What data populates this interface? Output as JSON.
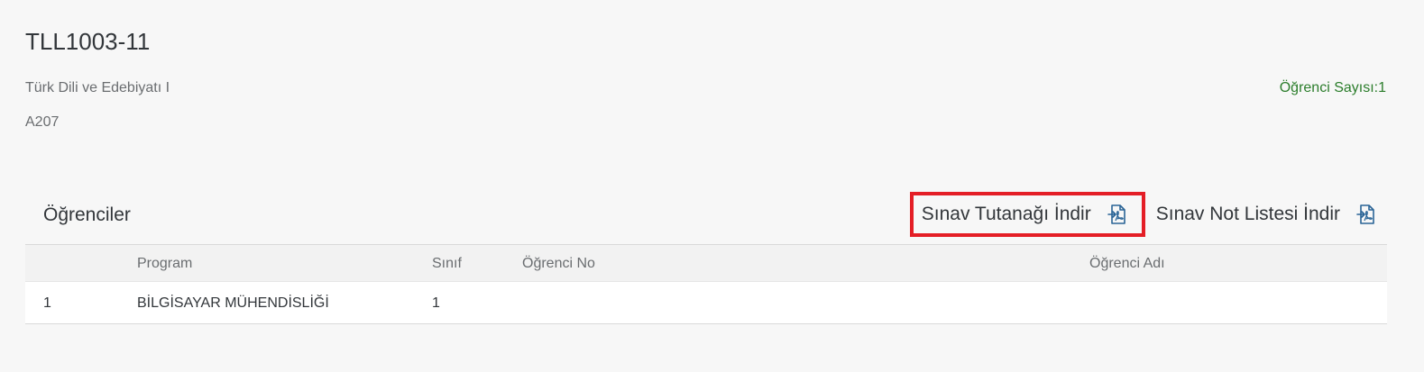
{
  "header": {
    "title": "TLL1003-11",
    "course_name": "Türk Dili ve Edebiyatı I",
    "room": "A207",
    "student_count": "Öğrenci Sayısı:1"
  },
  "students_table": {
    "title": "Öğrenciler",
    "actions": [
      {
        "label": "Sınav Tutanağı İndir",
        "icon": "pdf-download-icon"
      },
      {
        "label": "Sınav Not Listesi İndir",
        "icon": "pdf-download-icon"
      }
    ],
    "columns": [
      "",
      "Program",
      "Sınıf",
      "Öğrenci No",
      "Öğrenci Adı"
    ],
    "rows": [
      {
        "index": "1",
        "program": "BİLGİSAYAR MÜHENDİSLİĞİ",
        "class": "1",
        "student_no": "",
        "student_name": ""
      }
    ]
  },
  "colors": {
    "accent_icon": "#2a6496",
    "count_green": "#2b7d2b",
    "highlight_red": "#e41e26"
  }
}
